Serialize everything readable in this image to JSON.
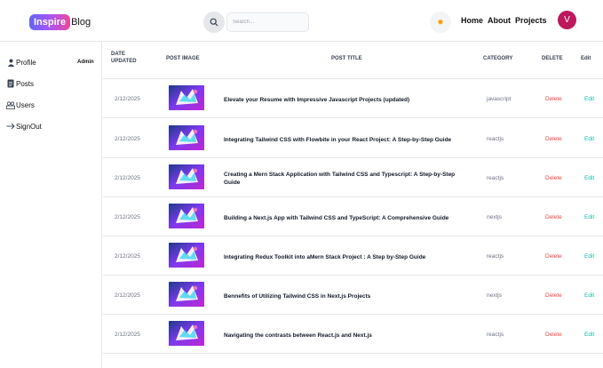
{
  "header": {
    "logo_highlight": "Inspire",
    "logo_rest": "Blog",
    "search_placeholder": "Search...",
    "nav": [
      "Home",
      "About",
      "Projects"
    ],
    "avatar_initial": "V"
  },
  "sidebar": {
    "items": [
      {
        "icon": "user-icon",
        "label": "Profile"
      },
      {
        "icon": "document-icon",
        "label": "Posts"
      },
      {
        "icon": "users-icon",
        "label": "Users"
      },
      {
        "icon": "arrow-right-icon",
        "label": "SignOut"
      }
    ],
    "admin_badge": "Admin"
  },
  "table": {
    "headers": {
      "date": "Date Updated",
      "image": "Post Image",
      "title": "Post Title",
      "category": "Category",
      "delete": "Delete",
      "edit": "Edit"
    },
    "rows": [
      {
        "date": "2/12/2025",
        "title": "Elevate your Resume with Impressive Javascript Projects (updated)",
        "category": "javascript",
        "delete": "Delete",
        "edit": "Edit"
      },
      {
        "date": "2/12/2025",
        "title": "Integrating Tailwind CSS with Flowbite in your React Project: A Step-by-Step Guide",
        "category": "reactjs",
        "delete": "Delete",
        "edit": "Edit"
      },
      {
        "date": "2/12/2025",
        "title": "Creating a Mern Stack Application with Tailwind CSS and Typescript: A Step-by-Step Guide",
        "category": "reactjs",
        "delete": "Delete",
        "edit": "Edit"
      },
      {
        "date": "2/12/2025",
        "title": "Building a Next.js App with Tailwind CSS and TypeScript: A Comprehensive Guide",
        "category": "nextjs",
        "delete": "Delete",
        "edit": "Edit"
      },
      {
        "date": "2/12/2025",
        "title": "Integrating Redux Toolkit into aMern Stack Project : A Step by-Step Guide",
        "category": "reactjs",
        "delete": "Delete",
        "edit": "Edit"
      },
      {
        "date": "2/12/2025",
        "title": "Bennefits of Utilizing Tailwind CSS in Next.js Projects",
        "category": "nextjs",
        "delete": "Delete",
        "edit": "Edit"
      },
      {
        "date": "2/12/2025",
        "title": "Navigating the contrasts between React.js and Next.js",
        "category": "reactjs",
        "delete": "Delete",
        "edit": "Edit"
      }
    ]
  },
  "colors": {
    "delete": "#ef4444",
    "edit": "#14b8a6",
    "avatar": "#be185d",
    "thumb_bg": "#2e1065"
  }
}
